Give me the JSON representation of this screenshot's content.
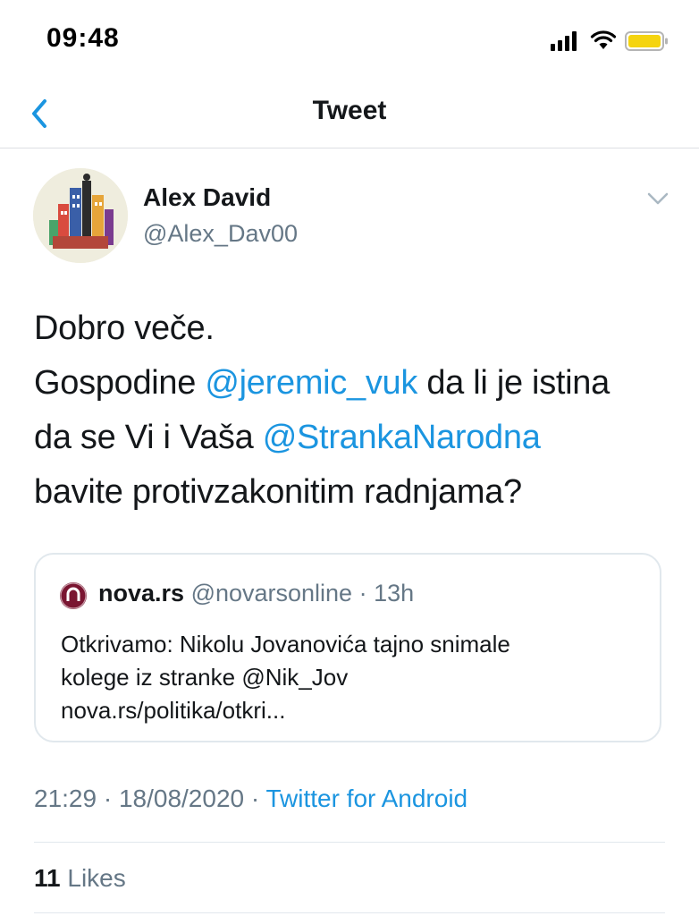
{
  "status_bar": {
    "time": "09:48",
    "icons": [
      "signal-icon",
      "wifi-icon",
      "battery-icon"
    ],
    "battery_color": "#f5d40f"
  },
  "nav": {
    "title": "Tweet",
    "back_icon": "chevron-left-icon",
    "accent_color": "#1b95e0"
  },
  "tweet": {
    "author_name": "Alex David",
    "author_handle": "@Alex_Dav00",
    "text_lines": [
      {
        "parts": [
          "Dobro veče."
        ]
      },
      {
        "parts": [
          "Gospodine ",
          "@jeremic_vuk",
          " da li je istina"
        ]
      },
      {
        "parts": [
          "da se Vi i Vaša ",
          "@StrankaNarodna"
        ]
      },
      {
        "parts": [
          "bavite protivzakonitim radnjama?"
        ]
      }
    ],
    "mentions": [
      "@jeremic_vuk",
      "@StrankaNarodna"
    ],
    "timestamp": "21:29 · 18/08/2020 · ",
    "source": "Twitter for Android",
    "likes_count": "11",
    "likes_label": " Likes"
  },
  "quote": {
    "name": "nova.rs",
    "handle": "@novarsonline",
    "time": " · 13h",
    "text_lines": [
      "Otkrivamo: Nikolu Jovanovića tajno snimale",
      "kolege iz stranke @Nik_Jov",
      "nova.rs/politika/otkri..."
    ],
    "logo_color": "#7a1531"
  },
  "colors": {
    "link": "#1b95e0",
    "secondary_text": "#657786",
    "primary_text": "#14171a",
    "border": "#e1e8ed"
  }
}
